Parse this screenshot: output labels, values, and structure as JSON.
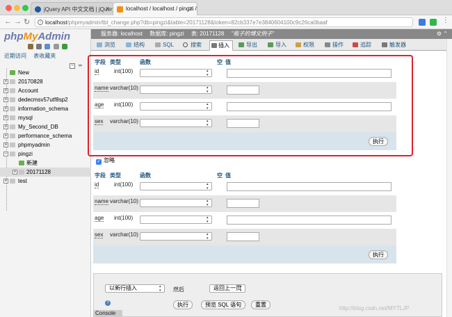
{
  "browser": {
    "tabs": [
      {
        "title": "jQuery API 中文文档 | jQuery A",
        "active": false
      },
      {
        "title": "localhost / localhost / pingzi / 2",
        "active": true
      }
    ],
    "url_host": "localhost",
    "url_path": "/phpmyadmin/tbl_change.php?db=pingzi&table=20171128&token=82cb337e7e3840604100c9c26ca0baaf"
  },
  "sidebar": {
    "logo_php": "php",
    "logo_my": "My",
    "logo_admin": "Admin",
    "tabs": [
      "近期访问",
      "表收藏夹"
    ],
    "tree": [
      {
        "label": "New"
      },
      {
        "label": "20170828"
      },
      {
        "label": "Account"
      },
      {
        "label": "dedecmsv57utf8sp2"
      },
      {
        "label": "information_schema"
      },
      {
        "label": "mysql"
      },
      {
        "label": "My_Second_DB"
      },
      {
        "label": "performance_schema"
      },
      {
        "label": "phpmyadmin"
      },
      {
        "label": "pingzi"
      },
      {
        "label": "新建"
      },
      {
        "label": "20171128"
      },
      {
        "label": "test"
      }
    ]
  },
  "breadcrumb": {
    "server": "服务器: localhost",
    "database": "数据库: pingzi",
    "table": "表: 20171128",
    "comment": "\"瓶子的博文例子\""
  },
  "tabs": [
    "浏览",
    "结构",
    "SQL",
    "搜索",
    "插入",
    "导出",
    "导入",
    "权限",
    "操作",
    "追踪",
    "触发器"
  ],
  "form": {
    "headers": {
      "field": "字段",
      "type": "类型",
      "function": "函数",
      "null": "空",
      "value": "值"
    },
    "rows": [
      {
        "name": "id",
        "type": "int(100)"
      },
      {
        "name": "name",
        "type": "varchar(10)"
      },
      {
        "name": "age",
        "type": "int(100)"
      },
      {
        "name": "sex",
        "type": "varchar(10)"
      }
    ],
    "go_button": "执行"
  },
  "ignore_label": "忽略",
  "bottom": {
    "insert_mode": "以新行插入",
    "after_label": "然后",
    "after_action": "返回上一页",
    "go_button": "执行",
    "preview_button": "预览 SQL 语句",
    "reset_button": "重置"
  },
  "console_label": "Console",
  "watermark": "http://blog.csdn.net/MYTLJP",
  "colors": {
    "logo_blue": "#6c78af",
    "logo_orange": "#f29111",
    "highlight_border": "#e01f2a",
    "link": "#235a81"
  }
}
